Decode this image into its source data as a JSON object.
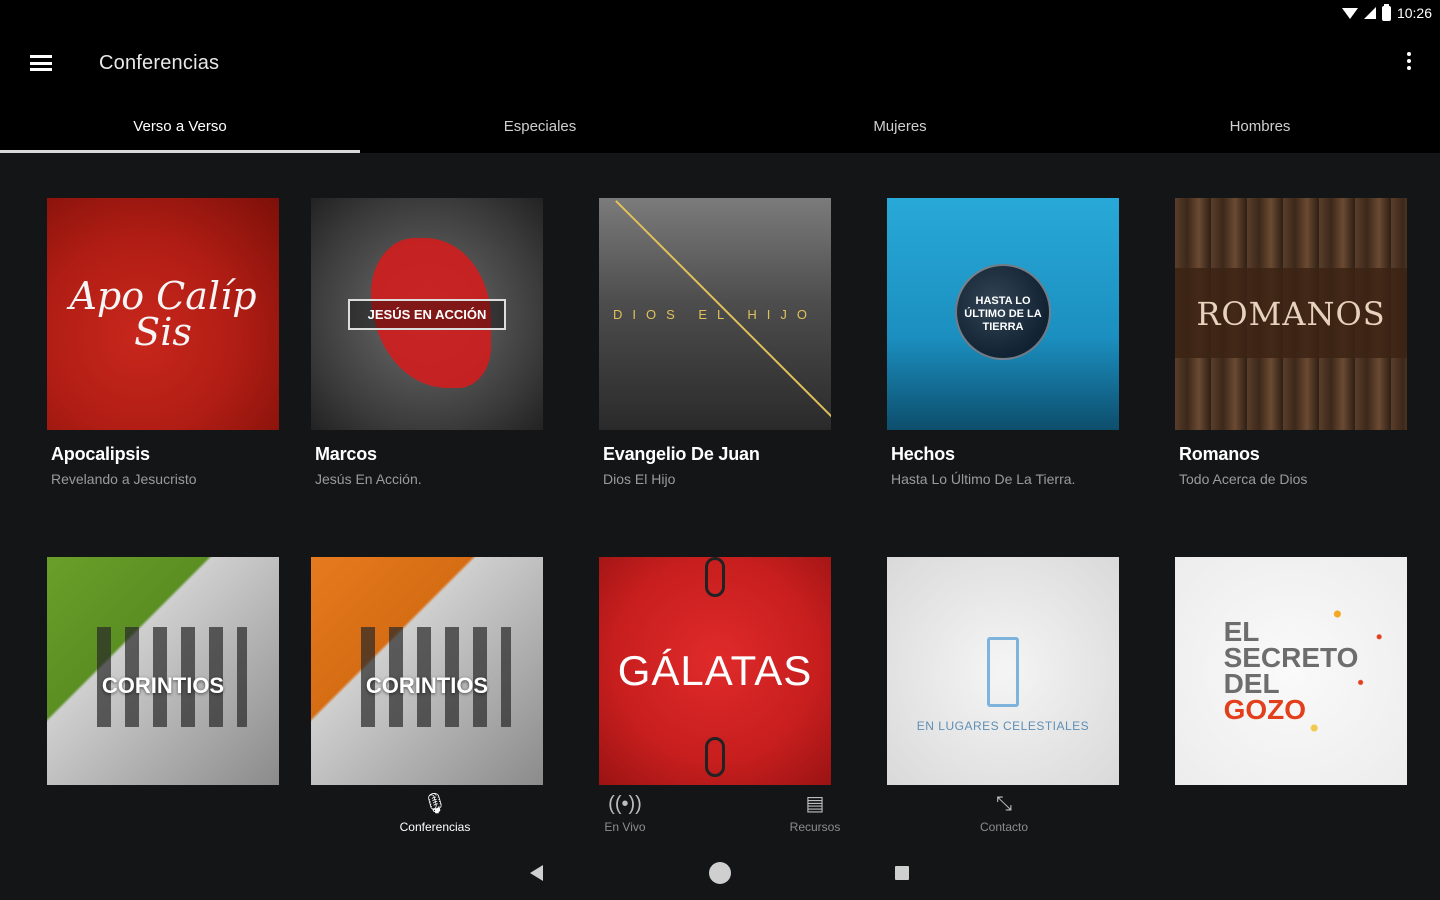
{
  "status_bar": {
    "time": "10:26"
  },
  "app_bar": {
    "title": "Conferencias"
  },
  "tabs": [
    {
      "label": "Verso a Verso",
      "active": true
    },
    {
      "label": "Especiales"
    },
    {
      "label": "Mujeres"
    },
    {
      "label": "Hombres"
    }
  ],
  "grid": [
    {
      "title": "Apocalipsis",
      "subtitle": "Revelando a Jesucristo",
      "cover_text": "Apo Calíp Sis",
      "cover_color": "#b01d14"
    },
    {
      "title": "Marcos",
      "subtitle": "Jesús En Acción.",
      "cover_text": "JESÚS EN ACCIÓN",
      "cover_color": "#3b3b3b"
    },
    {
      "title": "Evangelio De Juan",
      "subtitle": "Dios El Hijo",
      "cover_text": "DIOS EL HIJO",
      "cover_color": "#4d4d4d"
    },
    {
      "title": "Hechos",
      "subtitle": "Hasta Lo Último De La Tierra.",
      "cover_text": "HASTA LO ÚLTIMO DE LA TIERRA",
      "cover_color": "#1b8fc0"
    },
    {
      "title": "Romanos",
      "subtitle": "Todo Acerca de Dios",
      "cover_text": "ROMANOS",
      "cover_color": "#3c281a"
    },
    {
      "cover_text": "CORINTIOS",
      "cover_color": "#5b8f22"
    },
    {
      "cover_text": "CORINTIOS",
      "cover_color": "#d66d14"
    },
    {
      "cover_text": "GÁLATAS",
      "cover_color": "#c71e1e"
    },
    {
      "cover_text": "EN LUGARES CELESTIALES",
      "cover_color": "#e0e0e0"
    },
    {
      "cover_text_line1": "EL",
      "cover_text_line2": "SECRETO",
      "cover_text_line3": "DEL",
      "cover_text_line4": "GOZO",
      "cover_color": "#f0f0f0"
    }
  ],
  "bottom_nav": [
    {
      "label": "Conferencias",
      "icon": "microphone-icon",
      "active": true
    },
    {
      "label": "En Vivo",
      "icon": "broadcast-icon"
    },
    {
      "label": "Recursos",
      "icon": "book-icon"
    },
    {
      "label": "Contacto",
      "icon": "contact-icon"
    }
  ],
  "colors": {
    "background": "#141517",
    "appbar": "#000000",
    "text_secondary": "#9b9b9b"
  }
}
